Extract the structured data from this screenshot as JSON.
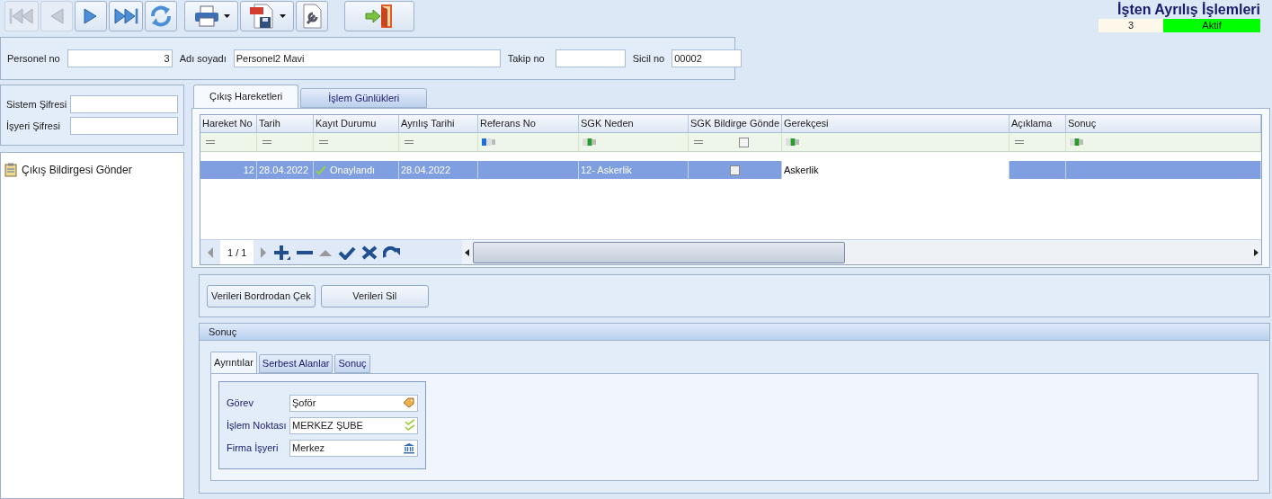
{
  "toolbar": [
    {
      "kind": "first",
      "disabled": true
    },
    {
      "kind": "previous",
      "disabled": true
    },
    {
      "kind": "next",
      "disabled": false
    },
    {
      "kind": "last",
      "disabled": false
    },
    {
      "kind": "refresh",
      "disabled": false
    },
    {
      "kind": "print",
      "disabled": false
    },
    {
      "kind": "pdf",
      "disabled": false
    },
    {
      "kind": "settings",
      "disabled": false
    },
    {
      "kind": "exit",
      "disabled": false
    }
  ],
  "header": {
    "title": "İşten Ayrılış İşlemleri",
    "count": "3",
    "status": "Aktif"
  },
  "personnel": [
    {
      "label": "Personel no",
      "value": "3",
      "kind": "number"
    },
    {
      "label": "Adı soyadı",
      "value": "Personel2 Mavi",
      "kind": "text"
    },
    {
      "label": "Takip no",
      "kind": "text"
    },
    {
      "label": "Sicil no",
      "value": "00002",
      "kind": "text"
    }
  ],
  "credentials": [
    {
      "label": "Sistem Şifresi"
    },
    {
      "label": "İşyeri Şifresi"
    }
  ],
  "tree": {
    "items": [
      {
        "label": "Çıkış Bildirgesi Gönder"
      }
    ]
  },
  "main_tabs": [
    {
      "label": "Çıkış Hareketleri",
      "selected": true
    },
    {
      "label": "İşlem Günlükleri",
      "selected": false
    }
  ],
  "grid": {
    "columns": [
      {
        "label": "Hareket No",
        "kind": "equals"
      },
      {
        "label": "Tarih",
        "kind": "equals"
      },
      {
        "label": "Kayıt Durumu",
        "kind": "equals"
      },
      {
        "label": "Ayrılış Tarihi",
        "kind": "equals"
      },
      {
        "label": "Referans No",
        "kind": "textblue"
      },
      {
        "label": "SGK Neden",
        "kind": "textgreen"
      },
      {
        "label": "SGK Bildirge Gönde",
        "kind": "checkbox",
        "filter_checked": false
      },
      {
        "label": "Gerekçesi",
        "kind": "textgreen"
      },
      {
        "label": "Açıklama",
        "kind": "equals"
      },
      {
        "label": "Sonuç",
        "kind": "textgreen"
      }
    ],
    "rows": [
      {
        "selected": true,
        "cells": [
          {
            "kind": "number",
            "text": "12"
          },
          {
            "kind": "text",
            "text": "28.04.2022"
          },
          {
            "kind": "status",
            "text": "Onaylandı"
          },
          {
            "kind": "text",
            "text": "28.04.2022"
          },
          {
            "kind": "empty"
          },
          {
            "kind": "text",
            "text": "12- Askerlik"
          },
          {
            "kind": "checkbox",
            "checked": false
          },
          {
            "kind": "editing",
            "text": "Askerlik"
          },
          {
            "kind": "empty"
          },
          {
            "kind": "empty"
          }
        ]
      }
    ]
  },
  "navigator": {
    "page": "1 / 1"
  },
  "actions": [
    "Verileri Bordrodan Çek",
    "Verileri Sil"
  ],
  "result_panel": {
    "title": "Sonuç",
    "tabs": [
      {
        "label": "Ayrıntılar",
        "selected": true
      },
      {
        "label": "Serbest Alanlar",
        "selected": false
      },
      {
        "label": "Sonuç",
        "selected": false
      }
    ],
    "fields": [
      {
        "label": "Görev",
        "value": "Şoför",
        "kind": "tag"
      },
      {
        "label": "İşlem Noktası",
        "value": "MERKEZ ŞUBE",
        "kind": "check"
      },
      {
        "label": "Firma İşyeri",
        "value": "Merkez",
        "kind": "bank"
      }
    ]
  }
}
